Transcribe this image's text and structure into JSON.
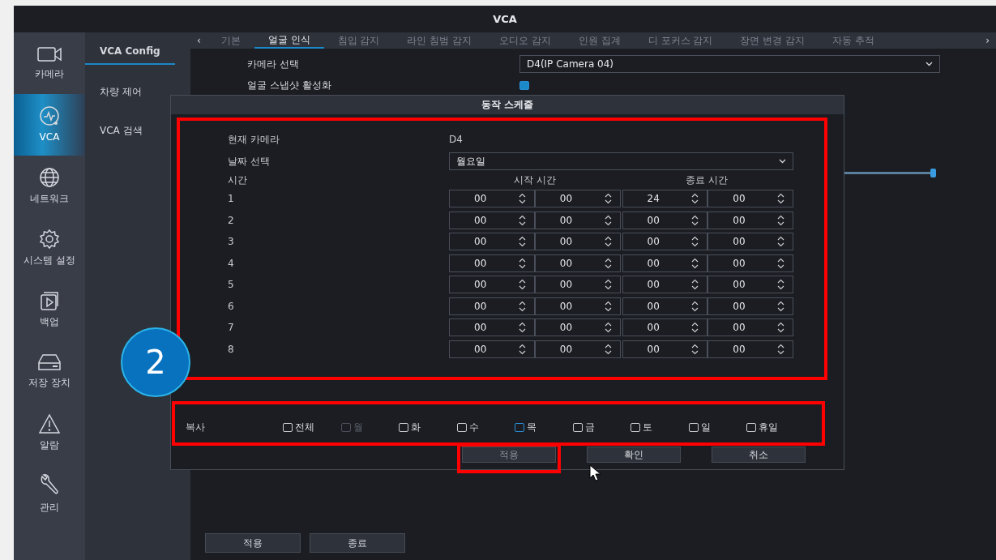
{
  "window": {
    "title": "VCA"
  },
  "main_menu": [
    {
      "label": "카메라",
      "selected": false
    },
    {
      "label": "VCA",
      "selected": true
    },
    {
      "label": "네트워크",
      "selected": false
    },
    {
      "label": "시스템 설정",
      "selected": false
    },
    {
      "label": "백업",
      "selected": false
    },
    {
      "label": "저장 장치",
      "selected": false
    },
    {
      "label": "알람",
      "selected": false
    },
    {
      "label": "관리",
      "selected": false
    }
  ],
  "sub_menu": [
    {
      "label": "VCA Config",
      "selected": true
    },
    {
      "label": "차량 제어",
      "selected": false
    },
    {
      "label": "VCA 검색",
      "selected": false
    }
  ],
  "tabs": [
    {
      "label": "기본",
      "selected": false
    },
    {
      "label": "얼굴 인식",
      "selected": true
    },
    {
      "label": "침입 감지",
      "selected": false
    },
    {
      "label": "라인 침범 감지",
      "selected": false
    },
    {
      "label": "오디오 감지",
      "selected": false
    },
    {
      "label": "인원 집계",
      "selected": false
    },
    {
      "label": "디 포커스 감지",
      "selected": false
    },
    {
      "label": "장면 변경 감지",
      "selected": false
    },
    {
      "label": "자동 추적",
      "selected": false
    }
  ],
  "settings": {
    "camera_label": "카메라 선택",
    "camera_value": "D4(IP Camera 04)",
    "snapshot_label": "얼굴 스냅샷 활성화",
    "snapshot_checked": true,
    "slider": {
      "level": 1
    }
  },
  "dialog": {
    "title": "동작 스케줄",
    "current_camera_label": "현재 카메라",
    "current_camera_value": "D4",
    "date_label": "날짜 선택",
    "date_value": "월요일",
    "time_label": "시간",
    "start_header": "시작 시간",
    "end_header": "종료 시간",
    "periods": [
      {
        "number": "1",
        "start_hour": "00",
        "start_minute": "00",
        "end_hour": "24",
        "end_minute": "00"
      },
      {
        "number": "2",
        "start_hour": "00",
        "start_minute": "00",
        "end_hour": "00",
        "end_minute": "00"
      },
      {
        "number": "3",
        "start_hour": "00",
        "start_minute": "00",
        "end_hour": "00",
        "end_minute": "00"
      },
      {
        "number": "4",
        "start_hour": "00",
        "start_minute": "00",
        "end_hour": "00",
        "end_minute": "00"
      },
      {
        "number": "5",
        "start_hour": "00",
        "start_minute": "00",
        "end_hour": "00",
        "end_minute": "00"
      },
      {
        "number": "6",
        "start_hour": "00",
        "start_minute": "00",
        "end_hour": "00",
        "end_minute": "00"
      },
      {
        "number": "7",
        "start_hour": "00",
        "start_minute": "00",
        "end_hour": "00",
        "end_minute": "00"
      },
      {
        "number": "8",
        "start_hour": "00",
        "start_minute": "00",
        "end_hour": "00",
        "end_minute": "00"
      }
    ],
    "copy_label": "복사",
    "copy_days": [
      {
        "label": "전체",
        "checked": false,
        "disabled": false,
        "focused": false
      },
      {
        "label": "월",
        "checked": false,
        "disabled": true,
        "focused": false
      },
      {
        "label": "화",
        "checked": false,
        "disabled": false,
        "focused": false
      },
      {
        "label": "수",
        "checked": false,
        "disabled": false,
        "focused": false
      },
      {
        "label": "목",
        "checked": false,
        "disabled": false,
        "focused": true
      },
      {
        "label": "금",
        "checked": false,
        "disabled": false,
        "focused": false
      },
      {
        "label": "토",
        "checked": false,
        "disabled": false,
        "focused": false
      },
      {
        "label": "일",
        "checked": false,
        "disabled": false,
        "focused": false
      },
      {
        "label": "휴일",
        "checked": false,
        "disabled": false,
        "focused": false
      }
    ],
    "buttons": [
      {
        "label": "적용",
        "disabled": true
      },
      {
        "label": "확인",
        "disabled": false
      },
      {
        "label": "취소",
        "disabled": false
      }
    ]
  },
  "tab_scroll": {
    "left": "‹",
    "right": "›"
  },
  "footer_buttons": [
    {
      "label": "적용"
    },
    {
      "label": "종료"
    }
  ],
  "annotation": {
    "step": "2"
  }
}
